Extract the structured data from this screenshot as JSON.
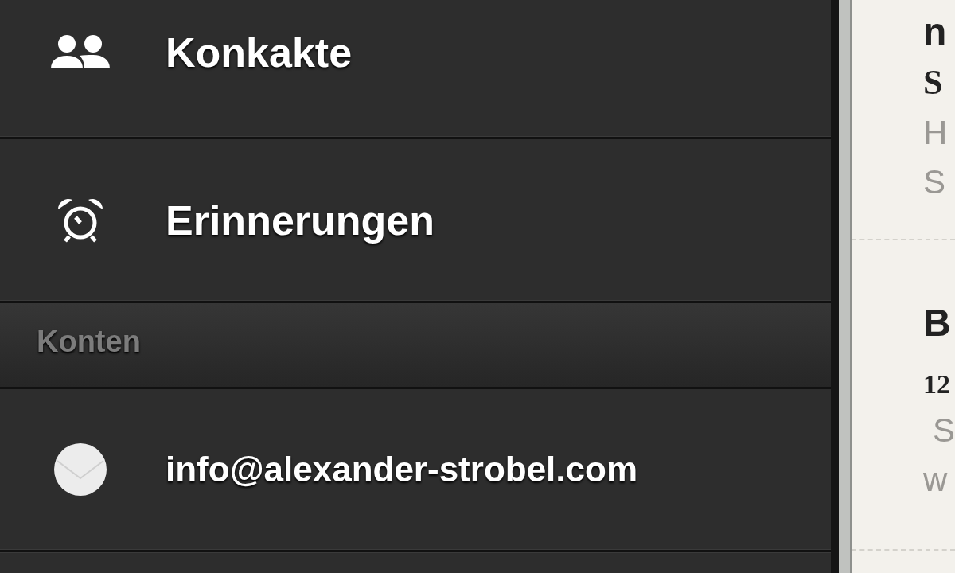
{
  "sidebar": {
    "items": [
      {
        "label": "Konkakte",
        "kind": "contacts"
      },
      {
        "label": "Erinnerungen",
        "kind": "reminders"
      }
    ],
    "section": {
      "title": "Konten"
    },
    "accounts": [
      {
        "label": "info@alexander-strobel.com",
        "kind": "mail"
      }
    ]
  },
  "message_list": {
    "items": [
      {
        "title": "n",
        "sender": "S",
        "lines": [
          "H",
          "S"
        ]
      },
      {
        "title": "B",
        "date": "12",
        "lines": [
          "S",
          "w"
        ]
      }
    ]
  }
}
